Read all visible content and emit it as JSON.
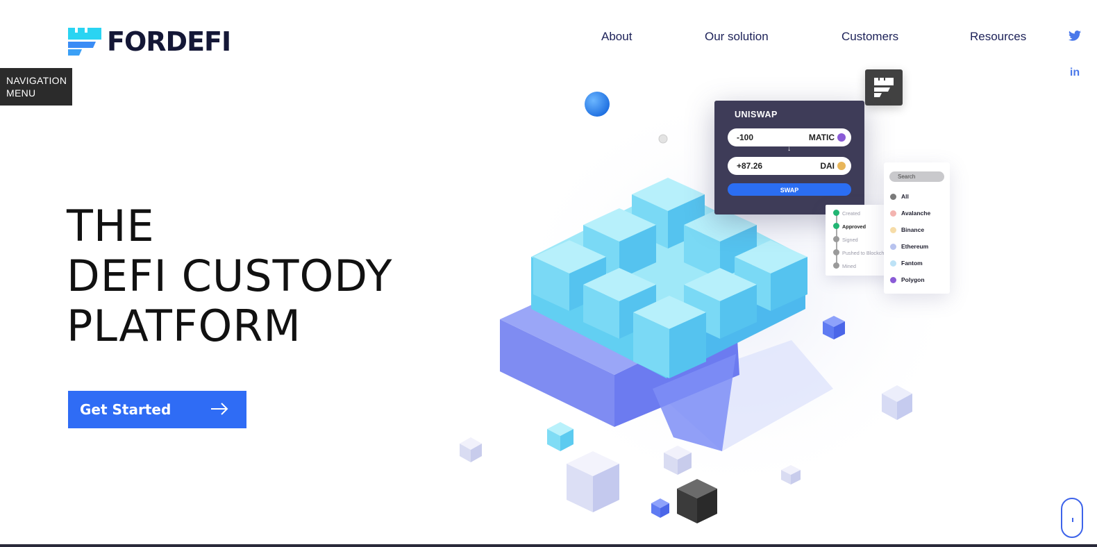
{
  "brand": {
    "name": "FORDEFI",
    "colors": {
      "cyan": "#2ad4f2",
      "blue": "#2f6cf5",
      "navy": "#141736"
    }
  },
  "nav": {
    "links": [
      {
        "label": "About"
      },
      {
        "label": "Our solution"
      },
      {
        "label": "Customers"
      },
      {
        "label": "Resources"
      }
    ],
    "social": [
      {
        "icon": "twitter-icon"
      },
      {
        "icon": "linkedin-icon",
        "label": "in"
      }
    ],
    "menu_button": {
      "line1": "NAVIGATION",
      "line2": "MENU"
    }
  },
  "hero": {
    "line1": "THE",
    "line2": "DEFI CUSTODY",
    "line3": "PLATFORM",
    "cta_label": "Get Started"
  },
  "uniswap_card": {
    "title": "UNISWAP",
    "from_amount": "-100",
    "from_token": "MATIC",
    "to_amount": "+87.26",
    "to_token": "DAI",
    "arrow": "↓",
    "swap_label": "SWAP"
  },
  "status_card": {
    "steps": [
      {
        "label": "Created",
        "done": true
      },
      {
        "label": "Approved",
        "done": true
      },
      {
        "label": "Signed",
        "done": false
      },
      {
        "label": "Pushed to Blockchain",
        "done": false
      },
      {
        "label": "Mined",
        "done": false
      }
    ]
  },
  "chain_card": {
    "search_placeholder": "Search",
    "chains": [
      {
        "label": "All",
        "color": "#7a7a7a"
      },
      {
        "label": "Avalanche",
        "color": "#f3b4b0"
      },
      {
        "label": "Binance",
        "color": "#f6dca8"
      },
      {
        "label": "Ethereum",
        "color": "#b8c3ee"
      },
      {
        "label": "Fantom",
        "color": "#bde2f6"
      },
      {
        "label": "Polygon",
        "color": "#8a5bd6"
      }
    ]
  },
  "scroll_indicator": {
    "label": "I"
  }
}
